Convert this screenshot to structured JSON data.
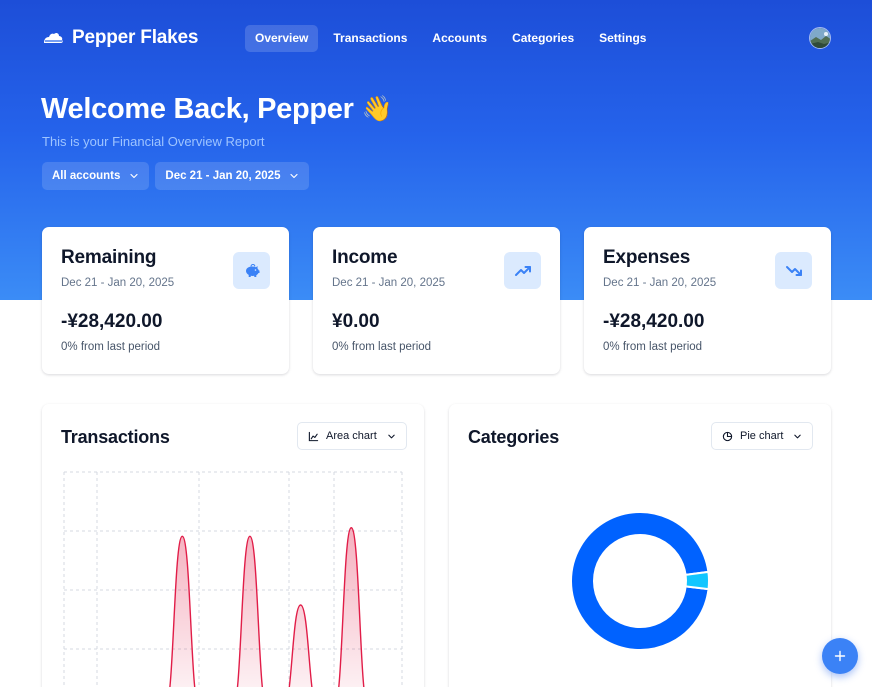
{
  "app": {
    "name": "Pepper Flakes",
    "logo_icon": "cloud-icon"
  },
  "nav": {
    "items": [
      {
        "label": "Overview",
        "active": true
      },
      {
        "label": "Transactions",
        "active": false
      },
      {
        "label": "Accounts",
        "active": false
      },
      {
        "label": "Categories",
        "active": false
      },
      {
        "label": "Settings",
        "active": false
      }
    ]
  },
  "hero": {
    "title": "Welcome Back, Pepper",
    "emoji": "👋",
    "subtitle": "This is your Financial Overview Report"
  },
  "filters": {
    "account": "All accounts",
    "date_range": "Dec 21 - Jan 20, 2025"
  },
  "cards": [
    {
      "title": "Remaining",
      "date": "Dec 21 - Jan 20, 2025",
      "value": "-¥28,420.00",
      "change": "0% from last period",
      "icon": "piggy-bank-icon"
    },
    {
      "title": "Income",
      "date": "Dec 21 - Jan 20, 2025",
      "value": "¥0.00",
      "change": "0% from last period",
      "icon": "trending-up-icon"
    },
    {
      "title": "Expenses",
      "date": "Dec 21 - Jan 20, 2025",
      "value": "-¥28,420.00",
      "change": "0% from last period",
      "icon": "trending-down-icon"
    }
  ],
  "transactions_panel": {
    "title": "Transactions",
    "chart_type_label": "Area chart"
  },
  "categories_panel": {
    "title": "Categories",
    "chart_type_label": "Pie chart"
  },
  "colors": {
    "accent": "#2563eb",
    "expense_line": "#e11d48",
    "donut_primary": "#0062ff",
    "donut_secondary": "#12c6ff"
  },
  "chart_data": [
    {
      "type": "area",
      "title": "Transactions",
      "series": [
        {
          "values": [
            0,
            0,
            0,
            0,
            0,
            0,
            0,
            100,
            0,
            0,
            0,
            100,
            0,
            0,
            60,
            0,
            0,
            105,
            0,
            0,
            0
          ]
        }
      ],
      "ylim": [
        0,
        120
      ],
      "grid": true
    },
    {
      "type": "pie",
      "title": "Categories",
      "values": [
        96,
        4
      ],
      "colors": [
        "#0062ff",
        "#12c6ff"
      ]
    }
  ]
}
